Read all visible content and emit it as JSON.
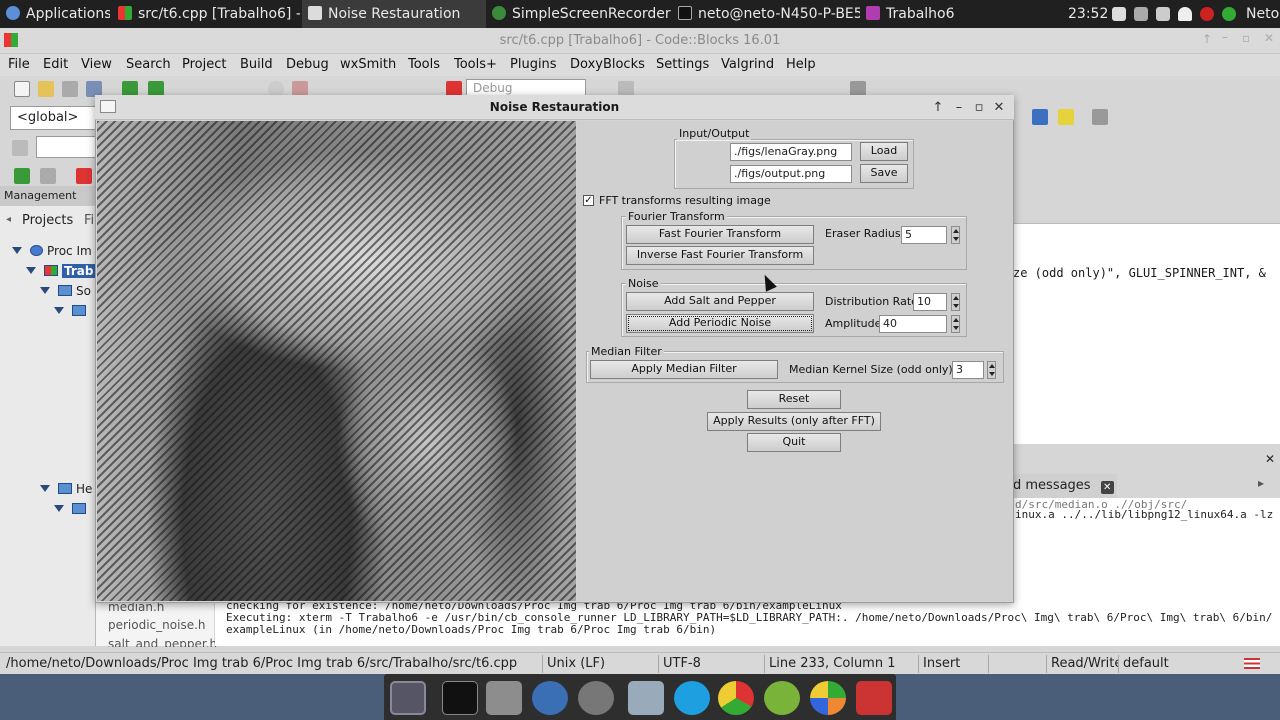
{
  "top_panel": {
    "applications": "Applications",
    "tasks": [
      "src/t6.cpp [Trabalho6] - ...",
      "Noise Restauration",
      "SimpleScreenRecorder",
      "neto@neto-N450-P-BE5...",
      "Trabalho6"
    ],
    "clock": "23:52",
    "user": "Neto"
  },
  "codeblocks": {
    "title": "src/t6.cpp [Trabalho6] - Code::Blocks 16.01",
    "menu": [
      "File",
      "Edit",
      "View",
      "Search",
      "Project",
      "Build",
      "Debug",
      "wxSmith",
      "Tools",
      "Tools+",
      "Plugins",
      "DoxyBlocks",
      "Settings",
      "Valgrind",
      "Help"
    ],
    "build_target": "Debug",
    "scope_combo": "<global>",
    "management": "Management",
    "projects_tab": "Projects",
    "files_tab_partial": "Fi",
    "tree": [
      "Proc Im",
      "Trab",
      "So",
      "He"
    ],
    "editor_line": "ze (odd only)\", GLUI_SPINNER_INT, &",
    "log_tab": "d messages",
    "log_lines": [
      "checking for existence: /home/neto/Downloads/Proc Img trab 6/Proc Img trab 6/bin/exampleLinux",
      "Executing: xterm -T Trabalho6 -e /usr/bin/cb_console_runner LD_LIBRARY_PATH=$LD_LIBRARY_PATH:. /home/neto/Downloads/Proc\\ Img\\ trab\\ 6/Proc\\ Img\\ trab\\ 6/bin/",
      "exampleLinux  (in /home/neto/Downloads/Proc Img trab 6/Proc Img trab 6/bin)"
    ],
    "log_right_1": "d/src/median.o .//obj/src/",
    "log_right_2": "inux.a ../../lib/libpng12_linux64.a -lz",
    "files": [
      "median.h",
      "periodic_noise.h",
      "salt_and_pepper.h"
    ],
    "status": {
      "path": "/home/neto/Downloads/Proc Img trab 6/Proc Img trab 6/src/Trabalho/src/t6.cpp",
      "eol": "Unix (LF)",
      "encoding": "UTF-8",
      "position": "Line 233, Column 1",
      "mode": "Insert",
      "access": "Read/Write",
      "profile": "default"
    }
  },
  "noise_window": {
    "title": "Noise Restauration",
    "io": {
      "group_label": "Input/Output",
      "input_path": "./figs/lenaGray.png",
      "output_path": "./figs/output.png",
      "load_label": "Load",
      "save_label": "Save"
    },
    "fft_checkbox_label": "FFT transforms resulting image",
    "fft_checkbox_mark": "✓",
    "fourier": {
      "group_label": "Fourier Transform",
      "fft_button": "Fast Fourier Transform",
      "ifft_button": "Inverse Fast Fourier Transform",
      "eraser_label": "Eraser Radius",
      "eraser_value": "5"
    },
    "noise": {
      "group_label": "Noise",
      "salt_button": "Add Salt and Pepper",
      "periodic_button": "Add Periodic Noise",
      "distribution_label": "Distribution Rate",
      "distribution_value": "10",
      "amplitude_label": "Amplitude",
      "amplitude_value": "40"
    },
    "median": {
      "group_label": "Median Filter",
      "apply_button": "Apply Median Filter",
      "kernel_label": "Median Kernel Size (odd only)",
      "kernel_value": "3"
    },
    "reset_button": "Reset",
    "apply_results_button": "Apply Results (only after FFT)",
    "quit_button": "Quit"
  },
  "colors": {
    "top_panel": "#202020",
    "window_bg": "#d4d4d4",
    "dock": "#2e2e2e"
  }
}
